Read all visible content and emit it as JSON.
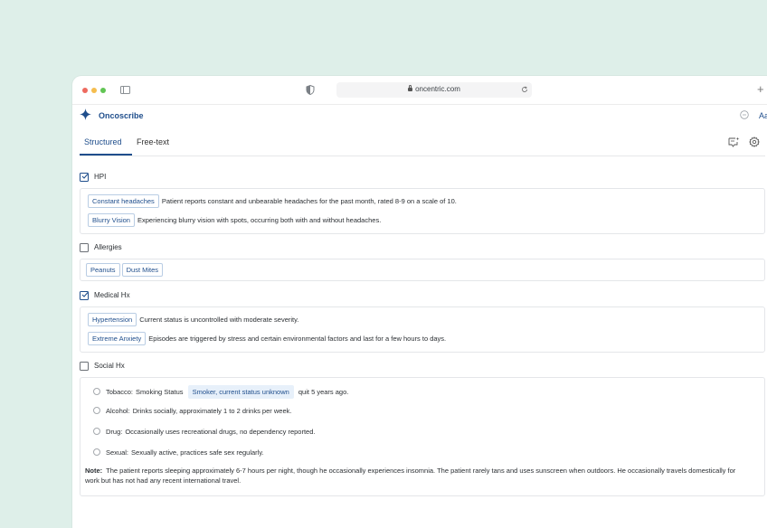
{
  "browser": {
    "url": "oncentric.com"
  },
  "app": {
    "name": "Oncoscribe",
    "font_size_label": "Aa"
  },
  "tabs": [
    {
      "label": "Structured",
      "active": true
    },
    {
      "label": "Free-text",
      "active": false
    }
  ],
  "sections": {
    "hpi": {
      "label": "HPI",
      "checked": true,
      "items": [
        {
          "tag": "Constant headaches",
          "text": "Patient reports constant and unbearable headaches for the past month, rated 8-9 on a scale of 10."
        },
        {
          "tag": "Blurry Vision",
          "text": "Experiencing blurry vision with spots, occurring both with and without headaches."
        }
      ]
    },
    "allergies": {
      "label": "Allergies",
      "checked": false,
      "tags": [
        "Peanuts",
        "Dust Mites"
      ]
    },
    "medical_hx": {
      "label": "Medical Hx",
      "checked": true,
      "items": [
        {
          "tag": "Hypertension",
          "text": "Current status is uncontrolled with moderate severity."
        },
        {
          "tag": "Extreme Anxiety",
          "text": "Episodes are triggered by stress and certain environmental factors and last for a few hours to days."
        }
      ]
    },
    "social_hx": {
      "label": "Social Hx",
      "checked": false,
      "rows": [
        {
          "key": "Tobacco:",
          "pre": "Smoking Status",
          "tag": "Smoker, current status unknown",
          "post": "quit 5 years ago."
        },
        {
          "key": "Alcohol:",
          "text": "Drinks socially, approximately 1 to 2 drinks per week."
        },
        {
          "key": "Drug:",
          "text": "Occasionally uses recreational drugs, no dependency reported."
        },
        {
          "key": "Sexual:",
          "text": "Sexually active, practices safe sex regularly."
        }
      ],
      "note_key": "Note:",
      "note": "The patient reports sleeping approximately 6-7 hours per night, though he occasionally experiences insomnia. The patient rarely tans and uses sunscreen when outdoors. He occasionally travels domestically for work but has not had any recent international travel."
    }
  },
  "colors": {
    "background": "#deefe9",
    "accent": "#1f4e8c",
    "chip_border": "#b9cde4",
    "chip_fill": "#e7f0fa"
  }
}
